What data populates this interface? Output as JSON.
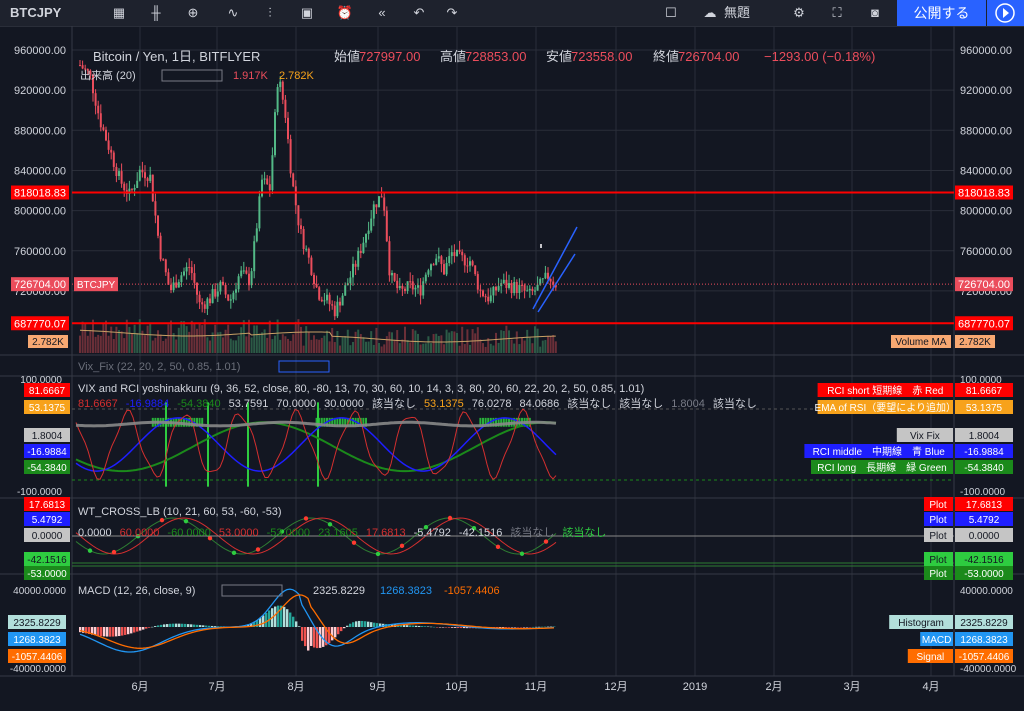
{
  "toolbar": {
    "symbol": "BTCJPY",
    "layout_name": "無題",
    "publish_label": "公開する",
    "icons": [
      "calendar-icon",
      "candles-icon",
      "plus-circle-icon",
      "line-icon",
      "indicators-icon",
      "template-icon",
      "alert-icon",
      "replay-icon",
      "undo-icon",
      "redo-icon",
      "layout-icon",
      "cloud-icon",
      "settings-icon",
      "fullscreen-icon",
      "camera-icon",
      "play-icon"
    ]
  },
  "legend": {
    "title": "Bitcoin / Yen, 1日, BITFLYER",
    "ohlc": [
      {
        "label": "始値",
        "value": "727997.00"
      },
      {
        "label": "高値",
        "value": "728853.00"
      },
      {
        "label": "安値",
        "value": "723558.00"
      },
      {
        "label": "終値",
        "value": "726704.00"
      }
    ],
    "change": "−1293.00 (−0.18%)",
    "volume_label": "出来高 (20)",
    "volume_values": [
      "1.917K",
      "2.782K"
    ]
  },
  "price_axis": {
    "ticks": [
      "960000.00",
      "920000.00",
      "880000.00",
      "840000.00",
      "800000.00",
      "760000.00",
      "720000.00"
    ],
    "tick_values": [
      960000,
      920000,
      880000,
      840000,
      800000,
      760000,
      720000
    ],
    "badge_hi": "818018.83",
    "badge_lo": "687770.07",
    "badge_last": "726704.00",
    "symbol_tag": "BTCJPY",
    "volume_badge": "2.782K",
    "volume_ma_label": "Volume MA",
    "volume_ma_value": "2.782K"
  },
  "vixfix": {
    "label": "Vix_Fix (22, 20, 2, 50, 0.85, 1.01)"
  },
  "rci_pane": {
    "title": "VIX and RCI yoshinakkuru (9, 36, 52, close, 80, -80, 13, 70, 30, 60, 10, 14, 3, 3, 80, 20, 60, 22, 20, 2, 50, 0.85, 1.01)",
    "values_line": [
      "81.6667",
      "-16.9884",
      "-54.3840",
      "53.7591",
      "70.0000",
      "30.0000",
      "該当なし",
      "53.1375",
      "76.0278",
      "84.0686",
      "該当なし",
      "該当なし",
      "1.8004",
      "該当なし"
    ],
    "axis": [
      "100.0000",
      "-100.0000"
    ],
    "left_badges": [
      "81.6667",
      "53.1375",
      "1.8004",
      "-16.9884",
      "-54.3840"
    ],
    "right_labels": [
      {
        "label": "RCI short 短期線　赤 Red",
        "value": "81.6667"
      },
      {
        "label": "EMA of RSI（要望により追加）",
        "value": "53.1375"
      },
      {
        "label": "Vix Fix",
        "value": "1.8004"
      },
      {
        "label": "RCI middle　中期線　青 Blue",
        "value": "-16.9884"
      },
      {
        "label": "RCI long　長期線　緑 Green",
        "value": "-54.3840"
      }
    ]
  },
  "wt_pane": {
    "title": "WT_CROSS_LB (10, 21, 60, 53, -60, -53)",
    "values_line": [
      "0.0000",
      "60.0000",
      "-60.0000",
      "53.0000",
      "-53.0000",
      "23.1605",
      "17.6813",
      "-5.4792",
      "-42.1516",
      "該当なし",
      "該当なし"
    ],
    "left_badges": [
      "17.6813",
      "5.4792",
      "0.0000",
      "-42.1516",
      "-53.0000"
    ],
    "right_labels": [
      {
        "label": "Plot",
        "value": "17.6813"
      },
      {
        "label": "Plot",
        "value": "5.4792"
      },
      {
        "label": "Plot",
        "value": "0.0000"
      },
      {
        "label": "Plot",
        "value": "-42.1516"
      },
      {
        "label": "Plot",
        "value": "-53.0000"
      }
    ]
  },
  "macd_pane": {
    "title": "MACD (12, 26, close, 9)",
    "values": [
      "2325.8229",
      "1268.3823",
      "-1057.4406"
    ],
    "axis_top": "40000.0000",
    "axis_bottom": "-40000.0000",
    "right_labels": [
      {
        "label": "Histogram",
        "value": "2325.8229"
      },
      {
        "label": "MACD",
        "value": "1268.3823"
      },
      {
        "label": "Signal",
        "value": "-1057.4406"
      }
    ]
  },
  "time_axis": [
    "6月",
    "7月",
    "8月",
    "9月",
    "10月",
    "11月",
    "12月",
    "2019",
    "2月",
    "3月",
    "4月"
  ],
  "colors": {
    "up": "#53b987",
    "down": "#eb4d5c",
    "level": "#ff0000",
    "blue_line": "#2962ff",
    "rci_red": "#d32f2f",
    "rci_blue": "#1e1eff",
    "rci_green": "#1b8a1b",
    "macd": "#2196f3",
    "signal": "#ff6d00"
  },
  "chart_data": {
    "type": "candlestick",
    "title": "Bitcoin / Yen, 1日, BITFLYER",
    "ylim": [
      687000,
      968000
    ],
    "levels": [
      818018.83,
      687770.07
    ],
    "last": 726704,
    "x": [
      "2018-05-15",
      "2018-06-01",
      "2018-06-15",
      "2018-07-01",
      "2018-07-15",
      "2018-08-01",
      "2018-08-15",
      "2018-09-01",
      "2018-09-15",
      "2018-10-01",
      "2018-10-15",
      "2018-11-01",
      "2018-11-10"
    ],
    "close": [
      930000,
      840000,
      720000,
      700000,
      740000,
      880000,
      735000,
      720000,
      810000,
      720000,
      755000,
      718000,
      726704
    ],
    "series": [
      {
        "name": "RCI short 短期線　赤 Red",
        "last": 81.6667
      },
      {
        "name": "RCI middle　中期線　青 Blue",
        "last": -16.9884
      },
      {
        "name": "RCI long　長期線　緑 Green",
        "last": -54.384
      },
      {
        "name": "MACD",
        "last": 1268.3823
      },
      {
        "name": "Signal",
        "last": -1057.4406
      },
      {
        "name": "Histogram",
        "last": 2325.8229
      }
    ]
  }
}
